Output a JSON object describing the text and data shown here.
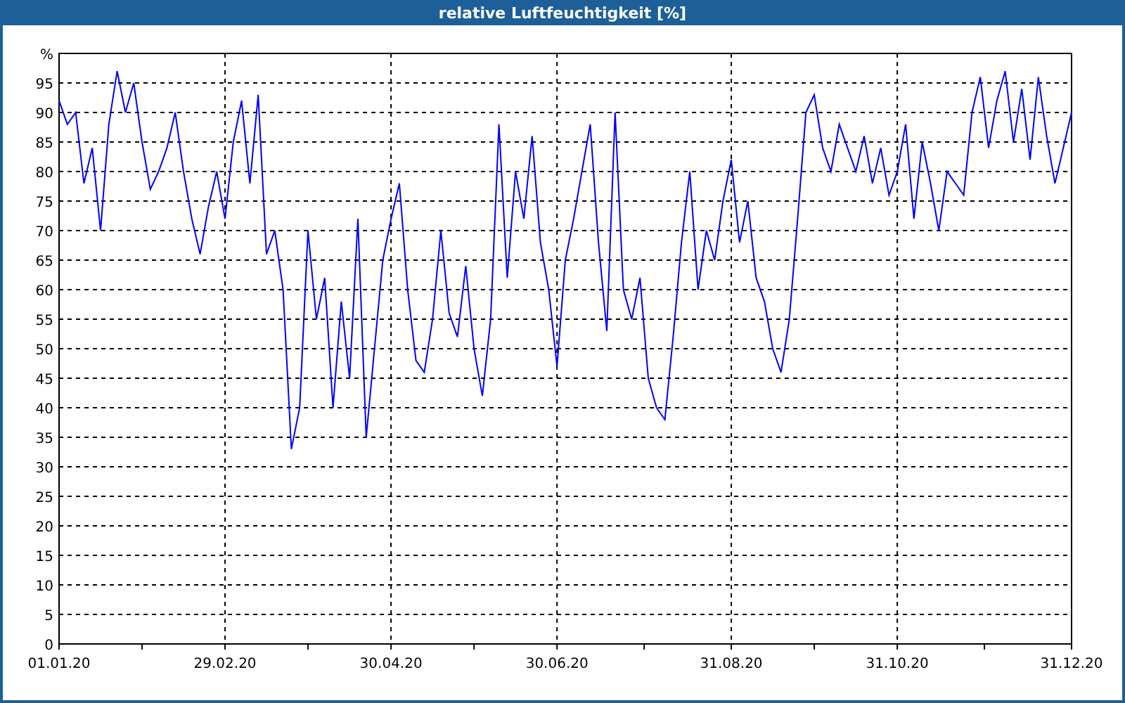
{
  "window": {
    "title": "relative Luftfeuchtigkeit [%]"
  },
  "chart": {
    "chart_data": {
      "type": "line",
      "grid": true,
      "ylim": [
        0,
        100
      ],
      "categories": [
        "01.01.20",
        null,
        null,
        null,
        null,
        null,
        null,
        null,
        null,
        null,
        null,
        null,
        null,
        null,
        null,
        null,
        null,
        null,
        null,
        null,
        "29.02.20",
        null,
        null,
        null,
        null,
        null,
        null,
        null,
        null,
        null,
        null,
        null,
        null,
        null,
        null,
        null,
        null,
        null,
        null,
        null,
        "30.04.20",
        null,
        null,
        null,
        null,
        null,
        null,
        null,
        null,
        null,
        null,
        null,
        null,
        null,
        null,
        null,
        null,
        null,
        null,
        null,
        "30.06.20",
        null,
        null,
        null,
        null,
        null,
        null,
        null,
        null,
        null,
        null,
        null,
        null,
        null,
        null,
        null,
        null,
        null,
        null,
        null,
        null,
        "31.08.20",
        null,
        null,
        null,
        null,
        null,
        null,
        null,
        null,
        null,
        null,
        null,
        null,
        null,
        null,
        null,
        null,
        null,
        null,
        null,
        "31.10.20",
        null,
        null,
        null,
        null,
        null,
        null,
        null,
        null,
        null,
        null,
        null,
        null,
        null,
        null,
        null,
        null,
        null,
        null,
        null,
        null,
        "31.12.20"
      ],
      "yticks": [
        0,
        5,
        10,
        15,
        20,
        25,
        30,
        35,
        40,
        45,
        50,
        55,
        60,
        65,
        70,
        75,
        80,
        85,
        90,
        95,
        {
          "value": 100,
          "label": "%"
        }
      ],
      "series": [
        {
          "color": "#0000ff",
          "values": [
            92,
            88,
            90,
            78,
            84,
            70,
            88,
            97,
            90,
            95,
            85,
            77,
            80,
            84,
            90,
            80,
            72,
            66,
            74,
            80,
            72,
            85,
            92,
            78,
            93,
            66,
            70,
            60,
            33,
            40,
            70,
            55,
            62,
            40,
            58,
            45,
            72,
            35,
            50,
            65,
            72,
            78,
            60,
            48,
            46,
            55,
            70,
            56,
            52,
            64,
            50,
            42,
            55,
            88,
            62,
            80,
            72,
            86,
            68,
            60,
            47,
            65,
            72,
            80,
            88,
            68,
            53,
            90,
            60,
            55,
            62,
            45,
            40,
            38,
            52,
            68,
            80,
            60,
            70,
            65,
            75,
            82,
            68,
            75,
            62,
            58,
            50,
            46,
            55,
            72,
            90,
            93,
            84,
            80,
            88,
            84,
            80,
            86,
            78,
            84,
            76,
            80,
            88,
            72,
            85,
            78,
            70,
            80,
            78,
            76,
            90,
            96,
            84,
            92,
            97,
            85,
            94,
            82,
            96,
            86,
            78,
            84,
            90
          ]
        }
      ]
    }
  }
}
